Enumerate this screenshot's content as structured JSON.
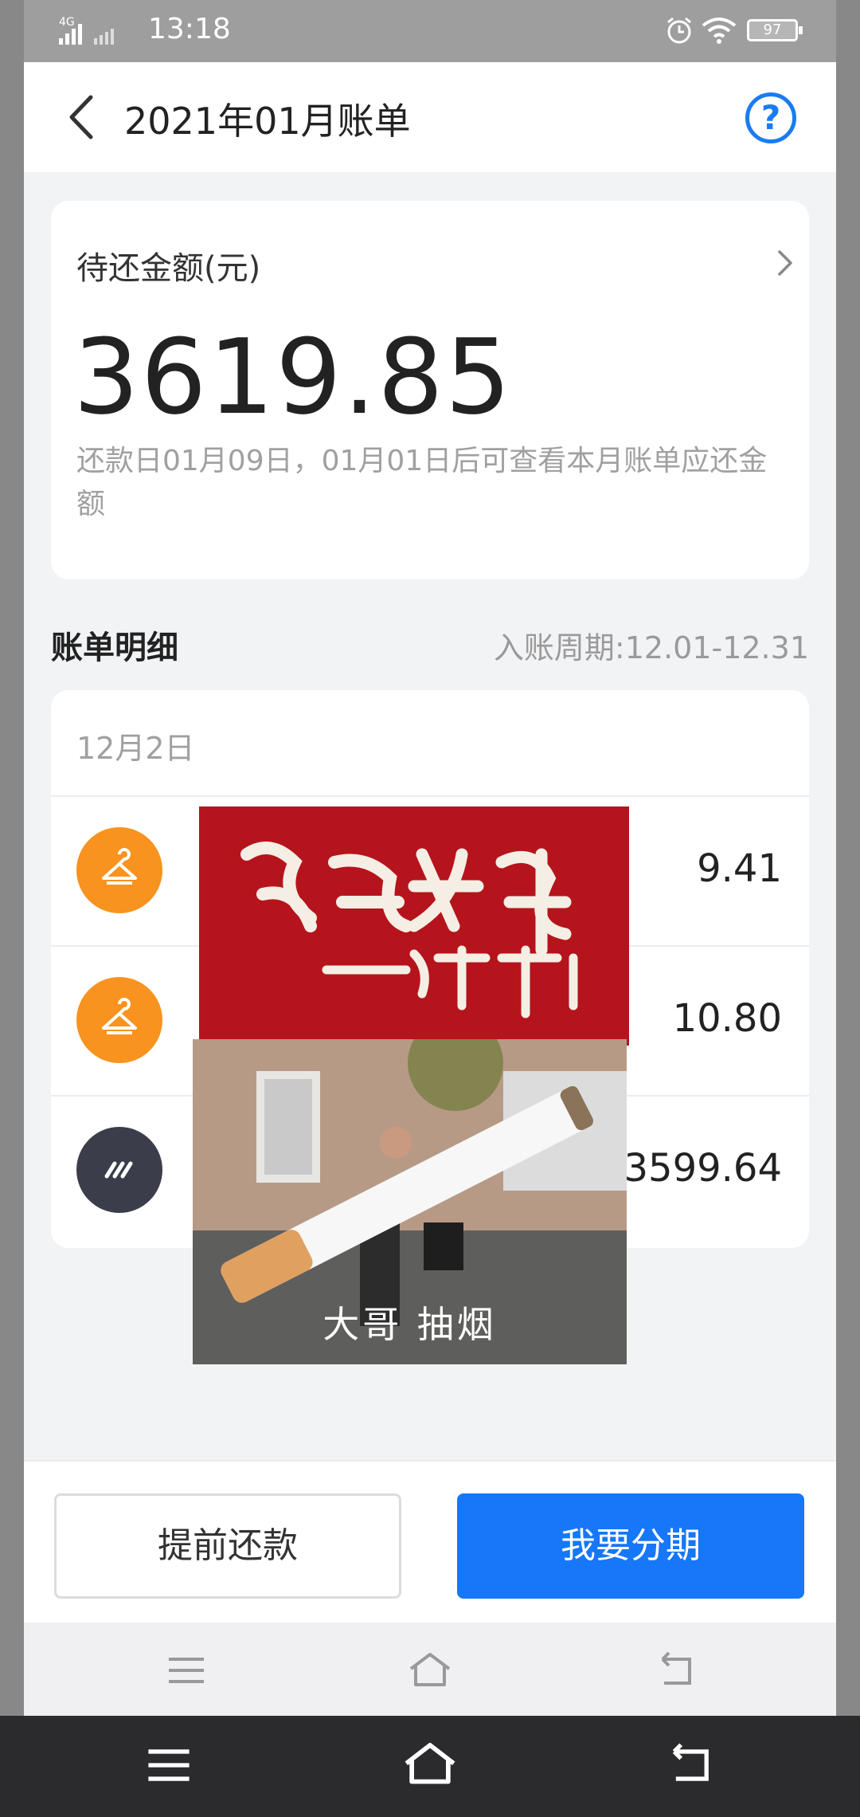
{
  "status_bar": {
    "network": "4G",
    "time": "13:18",
    "battery": "97"
  },
  "header": {
    "title": "2021年01月账单",
    "back_icon": "chevron-left-icon",
    "help_icon": "question-circle-icon",
    "help_label": "?"
  },
  "amount_card": {
    "label": "待还金额(元)",
    "value": "3619.85",
    "note": "还款日01月09日，01月01日后可查看本月账单应还金额"
  },
  "details": {
    "title": "账单明细",
    "period": "入账周期:12.01-12.31",
    "date": "12月2日",
    "items": [
      {
        "icon": "hanger-icon",
        "icon_color": "#f7931e",
        "amount": "9.41"
      },
      {
        "icon": "hanger-icon",
        "icon_color": "#f7931e",
        "amount": "10.80"
      },
      {
        "icon": "stripes-icon",
        "icon_color": "#3c3d4a",
        "amount": "3599.64"
      }
    ]
  },
  "overlay": {
    "caption": "大哥   抽烟"
  },
  "actions": {
    "prepay_label": "提前还款",
    "installment_label": "我要分期"
  },
  "colors": {
    "accent": "#1677f8",
    "orange": "#f7931e",
    "dark_icon": "#3c3d4a"
  }
}
